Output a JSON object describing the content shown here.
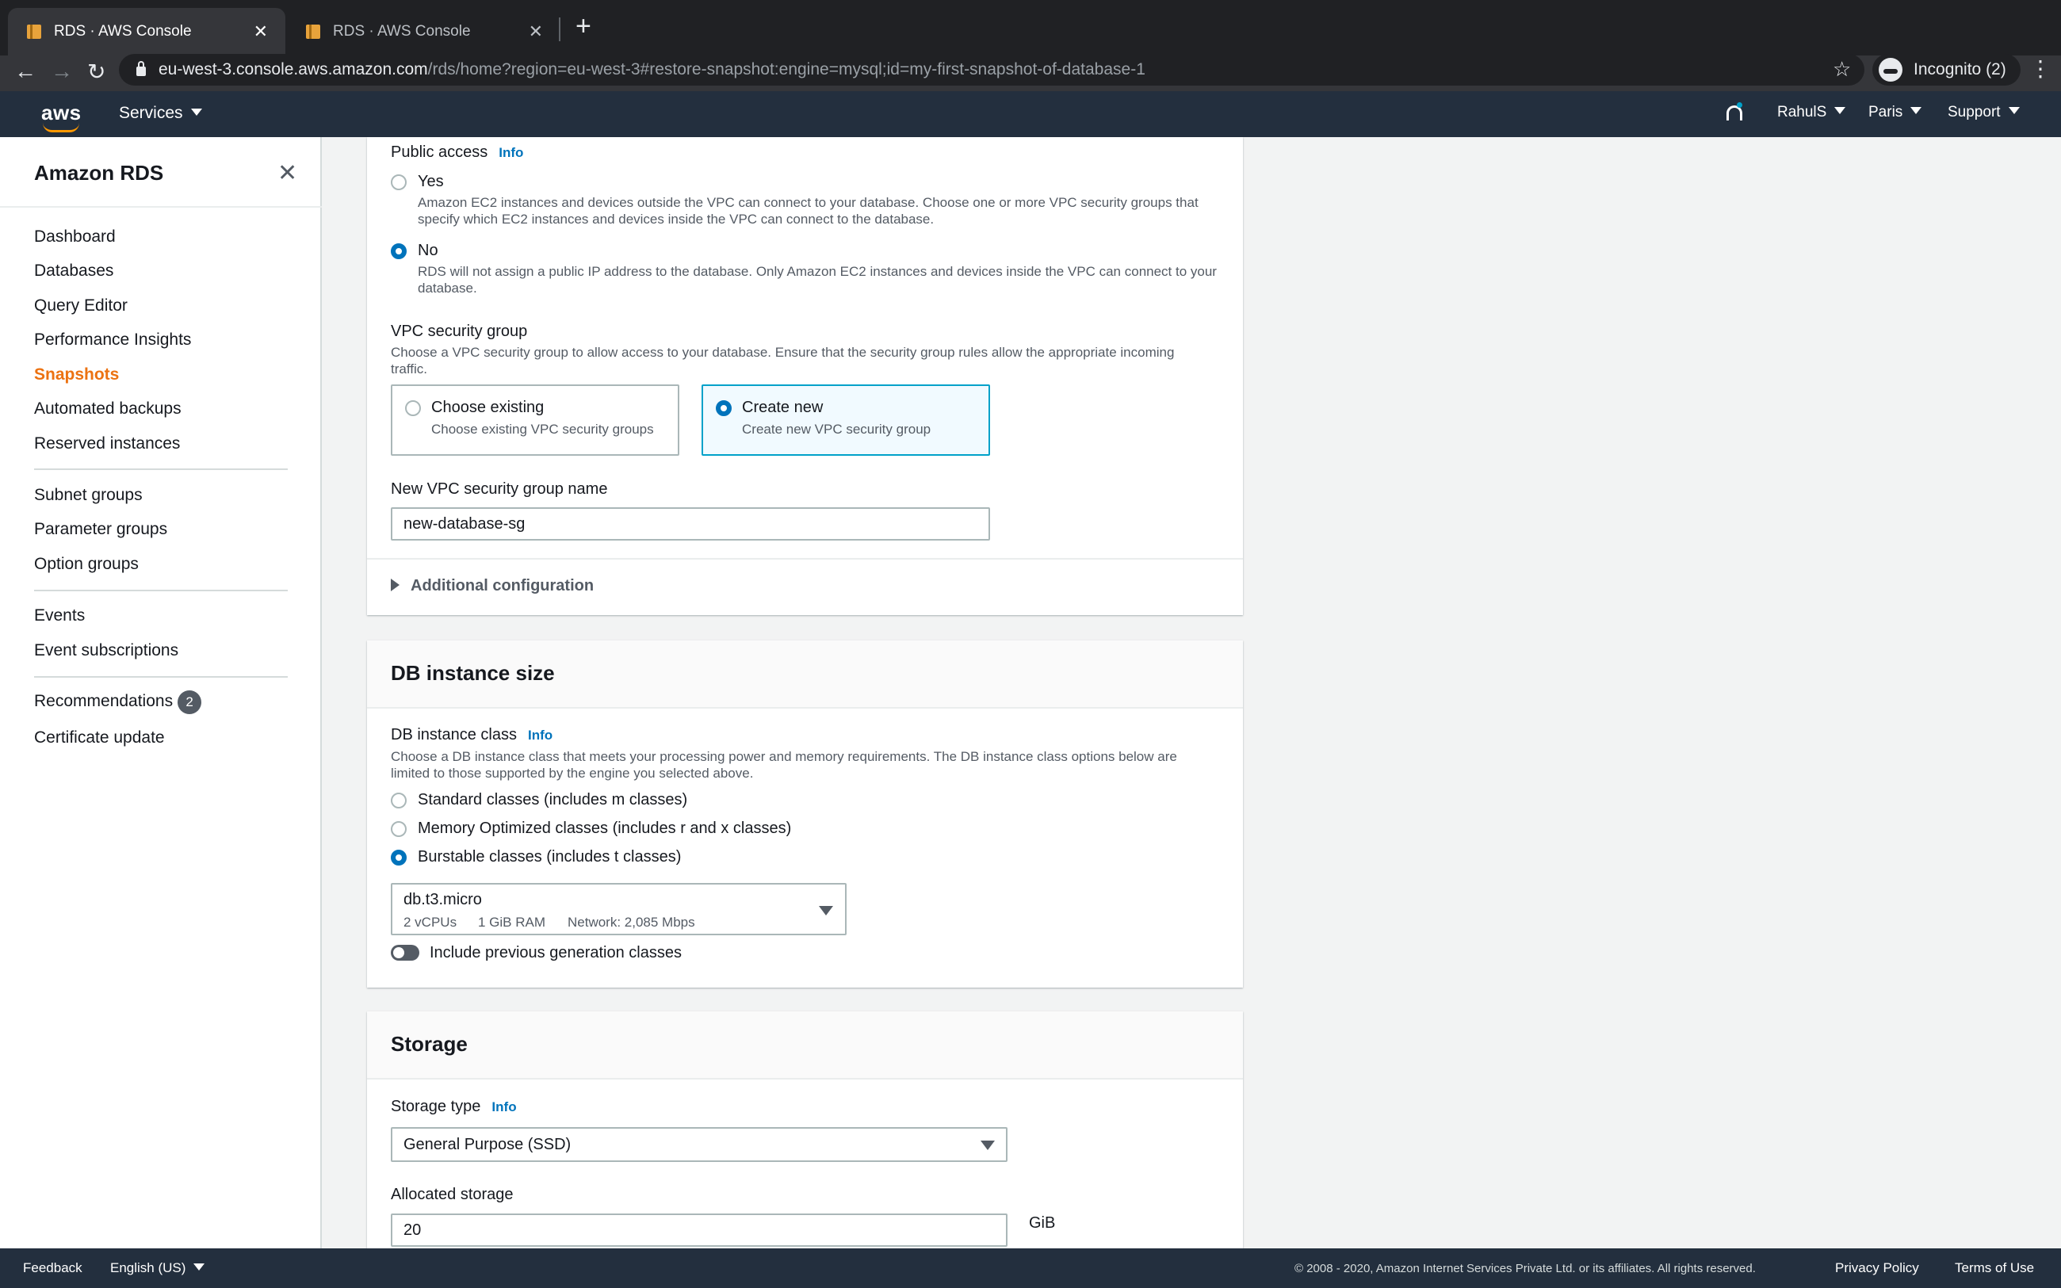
{
  "browser": {
    "tabs": [
      {
        "title": "RDS · AWS Console",
        "active": true
      },
      {
        "title": "RDS · AWS Console",
        "active": false
      }
    ],
    "url_host": "eu-west-3.console.aws.amazon.com",
    "url_path": "/rds/home?region=eu-west-3#restore-snapshot:engine=mysql;id=my-first-snapshot-of-database-1",
    "incognito_label": "Incognito (2)"
  },
  "header": {
    "logo_text": "aws",
    "services_label": "Services",
    "user": "RahulS",
    "region": "Paris",
    "support": "Support"
  },
  "sidebar": {
    "title": "Amazon RDS",
    "items": [
      {
        "label": "Dashboard"
      },
      {
        "label": "Databases"
      },
      {
        "label": "Query Editor"
      },
      {
        "label": "Performance Insights"
      },
      {
        "label": "Snapshots",
        "active": true
      },
      {
        "label": "Automated backups"
      },
      {
        "label": "Reserved instances"
      },
      {
        "label": "Subnet groups"
      },
      {
        "label": "Parameter groups"
      },
      {
        "label": "Option groups"
      },
      {
        "label": "Events"
      },
      {
        "label": "Event subscriptions"
      },
      {
        "label": "Recommendations",
        "badge": "2"
      },
      {
        "label": "Certificate update"
      }
    ]
  },
  "connectivity": {
    "public_access": {
      "label": "Public access",
      "info": "Info",
      "yes_label": "Yes",
      "yes_desc": "Amazon EC2 instances and devices outside the VPC can connect to your database. Choose one or more VPC security groups that specify which EC2 instances and devices inside the VPC can connect to the database.",
      "no_label": "No",
      "no_desc": "RDS will not assign a public IP address to the database. Only Amazon EC2 instances and devices inside the VPC can connect to your database.",
      "selected": "No"
    },
    "vpc_sg": {
      "label": "VPC security group",
      "desc": "Choose a VPC security group to allow access to your database. Ensure that the security group rules allow the appropriate incoming traffic.",
      "existing_label": "Choose existing",
      "existing_desc": "Choose existing VPC security groups",
      "new_label": "Create new",
      "new_desc": "Create new VPC security group",
      "selected": "Create new"
    },
    "new_sg_name": {
      "label": "New VPC security group name",
      "value": "new-database-sg"
    },
    "additional_config": "Additional configuration"
  },
  "instance_size": {
    "title": "DB instance size",
    "class_label": "DB instance class",
    "info": "Info",
    "class_desc": "Choose a DB instance class that meets your processing power and memory requirements. The DB instance class options below are limited to those supported by the engine you selected above.",
    "options": [
      {
        "label": "Standard classes (includes m classes)",
        "selected": false
      },
      {
        "label": "Memory Optimized classes (includes r and x classes)",
        "selected": false
      },
      {
        "label": "Burstable classes (includes t classes)",
        "selected": true
      }
    ],
    "selected_class": "db.t3.micro",
    "vcpus": "2 vCPUs",
    "ram": "1 GiB RAM",
    "network": "Network: 2,085 Mbps",
    "prev_gen_label": "Include previous generation classes",
    "prev_gen_on": false
  },
  "storage": {
    "title": "Storage",
    "type_label": "Storage type",
    "info": "Info",
    "type_value": "General Purpose (SSD)",
    "alloc_label": "Allocated storage",
    "alloc_value": "20",
    "alloc_unit": "GiB"
  },
  "footer": {
    "feedback": "Feedback",
    "language": "English (US)",
    "copyright": "© 2008 - 2020, Amazon Internet Services Private Ltd. or its affiliates. All rights reserved.",
    "privacy": "Privacy Policy",
    "terms": "Terms of Use"
  },
  "colors": {
    "accent": "#0073bb",
    "active_nav": "#ec7211",
    "header_bg": "#232f3e"
  }
}
